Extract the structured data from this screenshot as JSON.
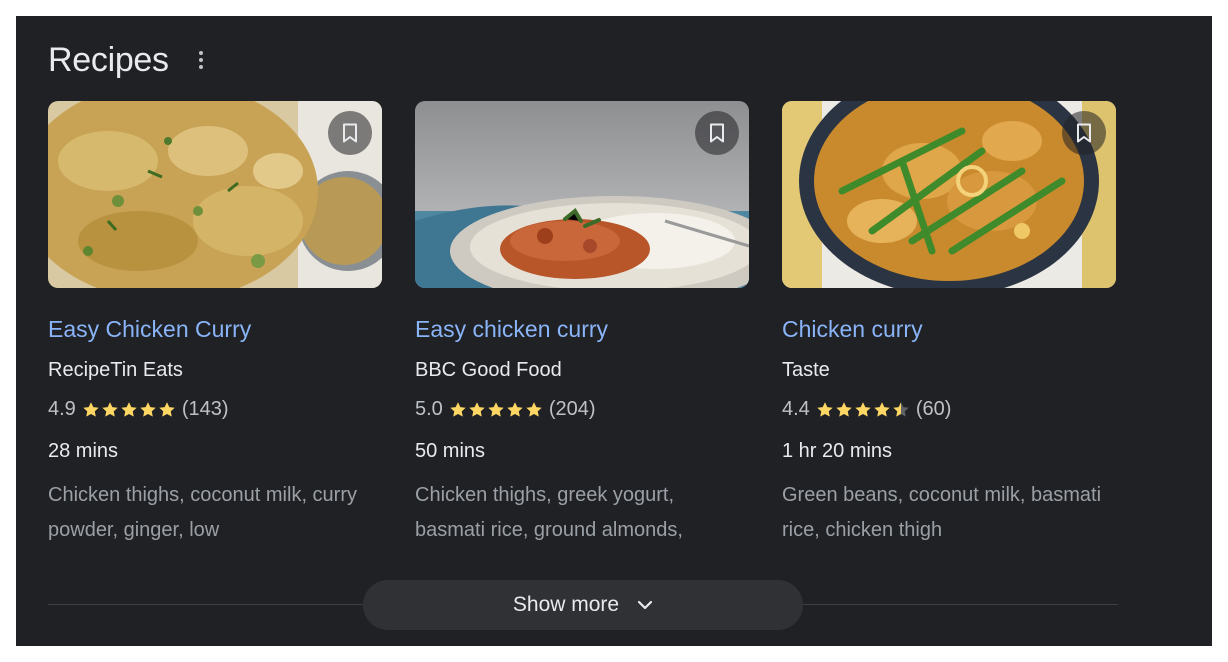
{
  "header": {
    "title": "Recipes",
    "menu_icon": "more-vertical-icon"
  },
  "cards": [
    {
      "title": "Easy Chicken Curry",
      "source": "RecipeTin Eats",
      "rating": "4.9",
      "rating_value": 4.9,
      "stars_filled": 5,
      "reviews": "(143)",
      "time": "28 mins",
      "ingredients": "Chicken thighs, coconut milk, curry powder, ginger, low",
      "image_icon": "curry-photo",
      "bookmark_icon": "bookmark-icon"
    },
    {
      "title": "Easy chicken curry",
      "source": "BBC Good Food",
      "rating": "5.0",
      "rating_value": 5.0,
      "stars_filled": 5,
      "reviews": "(204)",
      "time": "50 mins",
      "ingredients": "Chicken thighs, greek yogurt, basmati rice, ground almonds,",
      "image_icon": "curry-with-rice-photo",
      "bookmark_icon": "bookmark-icon"
    },
    {
      "title": "Chicken curry",
      "source": "Taste",
      "rating": "4.4",
      "rating_value": 4.4,
      "stars_filled": 4.5,
      "reviews": "(60)",
      "time": "1 hr 20 mins",
      "ingredients": "Green beans, coconut milk, basmati rice, chicken thigh",
      "image_icon": "curry-bowl-with-beans-photo",
      "bookmark_icon": "bookmark-icon"
    }
  ],
  "footer": {
    "show_more_label": "Show more",
    "chevron_icon": "chevron-down-icon"
  },
  "colors": {
    "background": "#202124",
    "link": "#8ab4f8",
    "star": "#fdd663",
    "text": "#e8eaed",
    "muted": "#9aa0a6"
  }
}
